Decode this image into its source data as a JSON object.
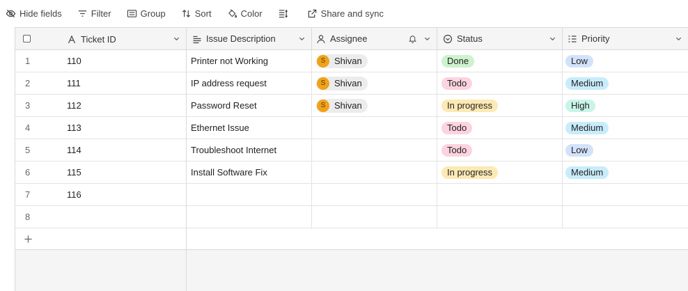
{
  "toolbar": {
    "hide_fields": "Hide fields",
    "filter": "Filter",
    "group": "Group",
    "sort": "Sort",
    "color": "Color",
    "share": "Share and sync"
  },
  "columns": {
    "ticket_id": "Ticket ID",
    "issue": "Issue Description",
    "assignee": "Assignee",
    "status": "Status",
    "priority": "Priority"
  },
  "rows": [
    {
      "num": "1",
      "id": "110",
      "issue": "Printer not Working",
      "assignee": "Shivan",
      "initial": "S",
      "status": "Done",
      "priority": "Low"
    },
    {
      "num": "2",
      "id": "111",
      "issue": "IP address request",
      "assignee": "Shivan",
      "initial": "S",
      "status": "Todo",
      "priority": "Medium"
    },
    {
      "num": "3",
      "id": "112",
      "issue": "Password Reset",
      "assignee": "Shivan",
      "initial": "S",
      "status": "In progress",
      "priority": "High"
    },
    {
      "num": "4",
      "id": "113",
      "issue": "Ethernet Issue",
      "assignee": "",
      "initial": "",
      "status": "Todo",
      "priority": "Medium"
    },
    {
      "num": "5",
      "id": "114",
      "issue": "Troubleshoot Internet",
      "assignee": "",
      "initial": "",
      "status": "Todo",
      "priority": "Low"
    },
    {
      "num": "6",
      "id": "115",
      "issue": "Install Software Fix",
      "assignee": "",
      "initial": "",
      "status": "In progress",
      "priority": "Medium"
    },
    {
      "num": "7",
      "id": "116",
      "issue": "",
      "assignee": "",
      "initial": "",
      "status": "",
      "priority": ""
    },
    {
      "num": "8",
      "id": "",
      "issue": "",
      "assignee": "",
      "initial": "",
      "status": "",
      "priority": ""
    }
  ],
  "colors": {
    "status": {
      "Done": "#cdf2cd",
      "Todo": "#fdd3df",
      "In progress": "#fde9b4"
    },
    "priority": {
      "Low": "#d3e2fb",
      "Medium": "#c8ecfb",
      "High": "#c9f4e8"
    }
  },
  "icons": {
    "add_row": "plus-icon"
  }
}
